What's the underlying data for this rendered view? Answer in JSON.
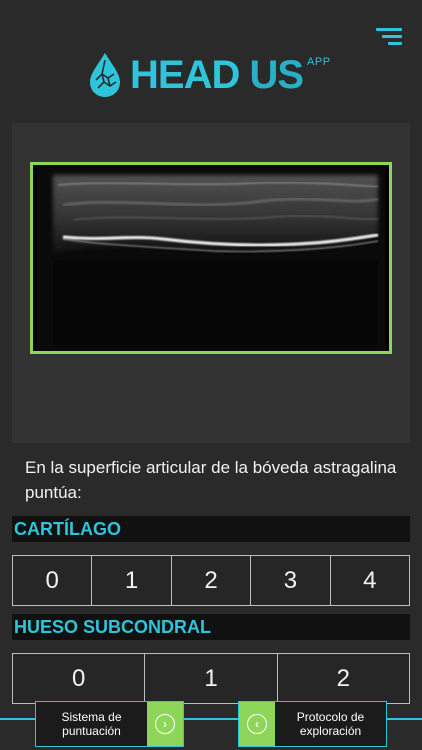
{
  "header": {
    "logo_main": "HEAD",
    "logo_us": "US",
    "logo_sup": "APP",
    "menu_icon": "hamburger-menu-icon"
  },
  "colors": {
    "accent": "#2ec4d9",
    "frame_green": "#8ed65a",
    "background": "#2a2a2a"
  },
  "question": "En la superficie articular de la bóveda astragalina puntúa:",
  "sections": [
    {
      "title": "CARTÍLAGO",
      "options": [
        "0",
        "1",
        "2",
        "3",
        "4"
      ]
    },
    {
      "title": "HUESO SUBCONDRAL",
      "options": [
        "0",
        "1",
        "2"
      ]
    }
  ],
  "footer": {
    "left_label": "Sistema de puntuación",
    "left_icon": "chevron-right-icon",
    "right_label": "Protocolo de exploración",
    "right_icon": "chevron-left-icon"
  }
}
